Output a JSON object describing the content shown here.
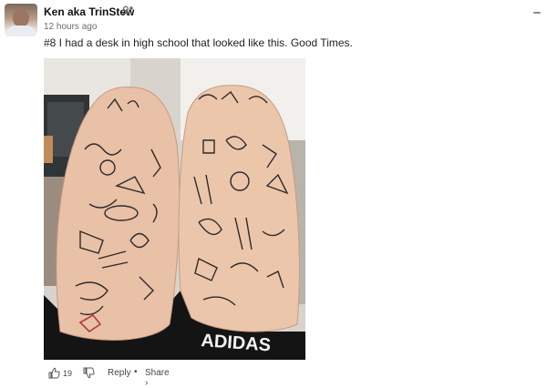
{
  "comment": {
    "author": "Ken aka TrinStew",
    "timestamp": "12 hours ago",
    "text": "#8 I had a desk in high school that looked like this. Good Times.",
    "likes": "19",
    "reply_label": "Reply",
    "separator": "•",
    "share_label": "Share ›"
  },
  "photo": {
    "shorts_text": "ADIDAS"
  },
  "colors": {
    "accent": "#1a73e8",
    "text_muted": "#6b6b6b"
  }
}
